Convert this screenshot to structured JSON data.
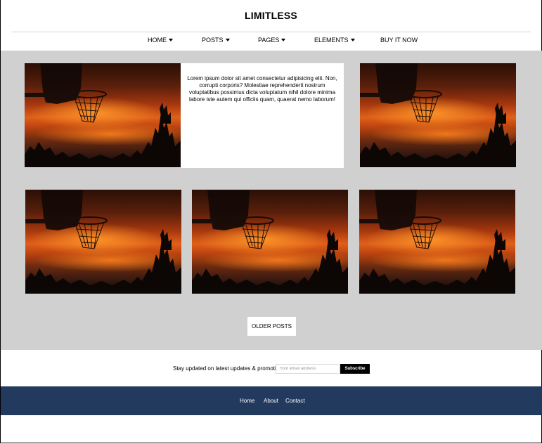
{
  "header": {
    "title": "LIMITLESS"
  },
  "nav": {
    "items": [
      {
        "label": "HOME",
        "has_dropdown": true
      },
      {
        "label": "POSTS",
        "has_dropdown": true
      },
      {
        "label": "PAGES",
        "has_dropdown": true
      },
      {
        "label": "ELEMENTS",
        "has_dropdown": true
      },
      {
        "label": "BUY IT NOW",
        "has_dropdown": false
      }
    ]
  },
  "posts": {
    "featured_text": "Lorem ipsum dolor sit amet consectetur adipisicing elit. Non, corrupti corporis? Molestiae reprehenderit nostrum voluptatibus possimus dicta voluptatum nihil dolore minima labore iste autem qui officiis quam, quaerat nemo laborum!",
    "image_subject": "basketball hoop silhouette against sunset sky"
  },
  "pagination": {
    "older_label": "OLDER POSTS"
  },
  "newsletter": {
    "label": "Stay updated on latest updates & promotions",
    "email_placeholder": "Your email address",
    "email_value": "",
    "button_label": "Subscribe"
  },
  "footer": {
    "links": [
      {
        "label": "Home"
      },
      {
        "label": "About"
      },
      {
        "label": "Contact"
      }
    ]
  },
  "colors": {
    "background_gray": "#d0d0d0",
    "footer_navy": "#223a5e",
    "button_black": "#000000"
  }
}
